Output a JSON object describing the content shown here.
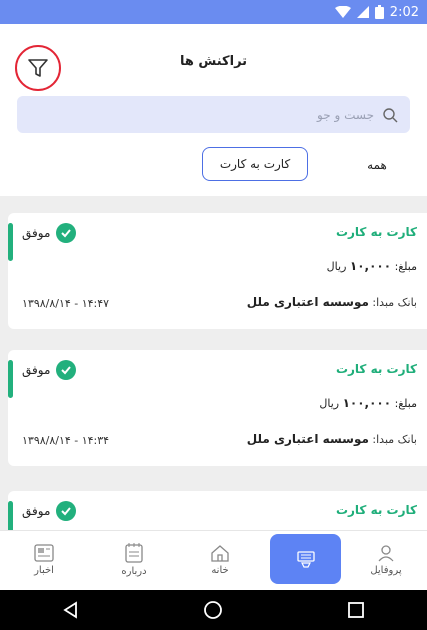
{
  "status_bar": {
    "time": "2:02"
  },
  "header": {
    "title": "تراکنش ها"
  },
  "search": {
    "placeholder": "جست و جو"
  },
  "filters": {
    "all_label": "همه",
    "card_to_card_label": "کارت به کارت"
  },
  "transactions": [
    {
      "type": "کارت به کارت",
      "status": "موفق",
      "amount_prefix": "مبلغ:",
      "amount": "۱۰,۰۰۰",
      "currency": "ریال",
      "bank_label": "بانک مبدا:",
      "bank": "موسسه اعتباری ملل",
      "datetime": "۱۳۹۸/۸/۱۴ - ۱۴:۴۷"
    },
    {
      "type": "کارت به کارت",
      "status": "موفق",
      "amount_prefix": "مبلغ:",
      "amount": "۱۰۰,۰۰۰",
      "currency": "ریال",
      "bank_label": "بانک مبدا:",
      "bank": "موسسه اعتباری ملل",
      "datetime": "۱۳۹۸/۸/۱۴ - ۱۴:۳۴"
    },
    {
      "type": "کارت به کارت",
      "status": "موفق"
    }
  ],
  "bottom_nav": {
    "news": "اخبار",
    "about": "درباره",
    "home": "خانه",
    "profile": "پروفایل"
  },
  "colors": {
    "accent_green": "#22b07d",
    "brand_blue": "#5d83f4",
    "filter_highlight": "#e32636"
  }
}
